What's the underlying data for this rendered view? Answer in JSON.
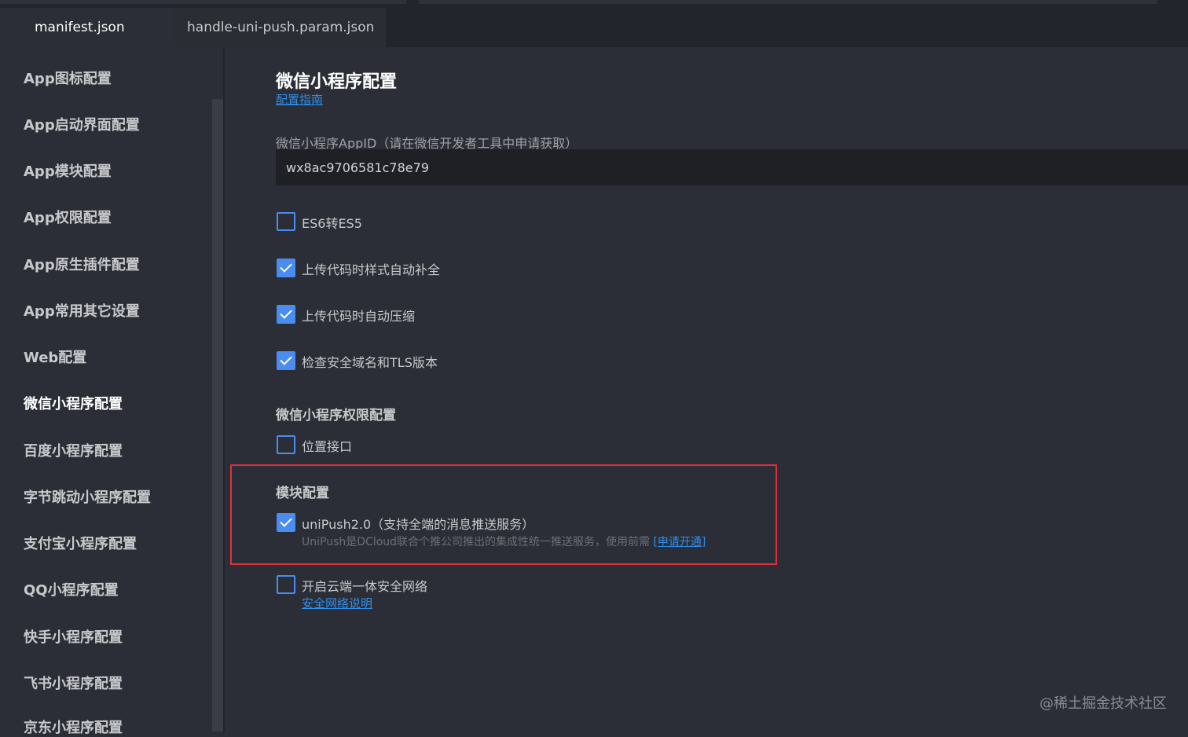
{
  "tabs": [
    {
      "label": "manifest.json",
      "active": true
    },
    {
      "label": "handle-uni-push.param.json",
      "active": false
    }
  ],
  "sidebar": {
    "items": [
      {
        "label": "App图标配置"
      },
      {
        "label": "App启动界面配置"
      },
      {
        "label": "App模块配置"
      },
      {
        "label": "App权限配置"
      },
      {
        "label": "App原生插件配置"
      },
      {
        "label": "App常用其它设置"
      },
      {
        "label": "Web配置"
      },
      {
        "label": "微信小程序配置",
        "active": true
      },
      {
        "label": "百度小程序配置"
      },
      {
        "label": "字节跳动小程序配置"
      },
      {
        "label": "支付宝小程序配置"
      },
      {
        "label": "QQ小程序配置"
      },
      {
        "label": "快手小程序配置"
      },
      {
        "label": "飞书小程序配置"
      },
      {
        "label": "京东小程序配置"
      }
    ]
  },
  "main": {
    "title": "微信小程序配置",
    "guide_link": "配置指南",
    "appid_label": "微信小程序AppID（请在微信开发者工具中申请获取）",
    "appid_value": "wx8ac9706581c78e79",
    "options": [
      {
        "label": "ES6转ES5",
        "checked": false
      },
      {
        "label": "上传代码时样式自动补全",
        "checked": true
      },
      {
        "label": "上传代码时自动压缩",
        "checked": true
      },
      {
        "label": "检查安全域名和TLS版本",
        "checked": true
      }
    ],
    "permission_section": {
      "title": "微信小程序权限配置",
      "location_label": "位置接口",
      "location_checked": false
    },
    "module_section": {
      "title": "模块配置",
      "unipush_label": "uniPush2.0（支持全端的消息推送服务）",
      "unipush_checked": true,
      "unipush_desc": "UniPush是DCloud联合个推公司推出的集成性统一推送服务，使用前需",
      "unipush_link": "[申请开通]"
    },
    "secure_network": {
      "label": "开启云端一体安全网络",
      "checked": false,
      "link": "安全网络说明"
    }
  },
  "watermark": "@稀土掘金技术社区",
  "colors": {
    "accent": "#4a8cf0",
    "link": "#2f8eed",
    "highlight": "#e0303a",
    "background": "#2b2e36"
  }
}
